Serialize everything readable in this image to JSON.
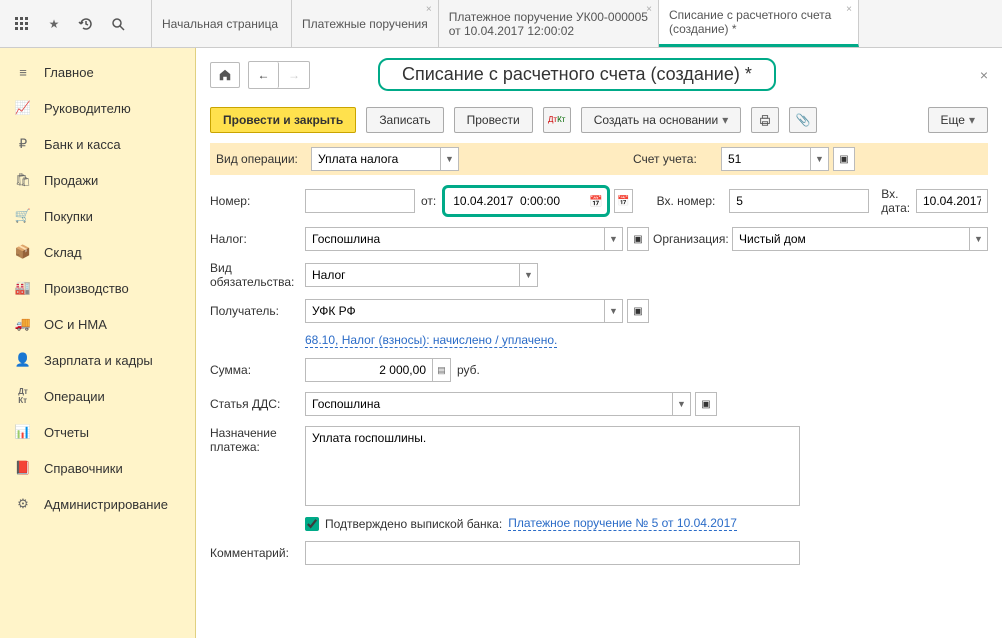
{
  "tabs": [
    {
      "label": "Начальная страница"
    },
    {
      "label": "Платежные поручения"
    },
    {
      "line1": "Платежное поручение УК00-000005",
      "line2": "от 10.04.2017 12:00:02"
    },
    {
      "line1": "Списание с расчетного счета",
      "line2": "(создание) *"
    }
  ],
  "sidebar": [
    {
      "label": "Главное",
      "icon": "home"
    },
    {
      "label": "Руководителю",
      "icon": "chart"
    },
    {
      "label": "Банк и касса",
      "icon": "ruble"
    },
    {
      "label": "Продажи",
      "icon": "bag"
    },
    {
      "label": "Покупки",
      "icon": "cart"
    },
    {
      "label": "Склад",
      "icon": "box"
    },
    {
      "label": "Производство",
      "icon": "factory"
    },
    {
      "label": "ОС и НМА",
      "icon": "truck"
    },
    {
      "label": "Зарплата и кадры",
      "icon": "person"
    },
    {
      "label": "Операции",
      "icon": "dtkt"
    },
    {
      "label": "Отчеты",
      "icon": "bars"
    },
    {
      "label": "Справочники",
      "icon": "book"
    },
    {
      "label": "Администрирование",
      "icon": "gear"
    }
  ],
  "title": "Списание с расчетного счета (создание) *",
  "toolbar": {
    "post_close": "Провести и закрыть",
    "save": "Записать",
    "post": "Провести",
    "create_based": "Создать на основании",
    "more": "Еще"
  },
  "form": {
    "op_type_label": "Вид операции:",
    "op_type_value": "Уплата налога",
    "account_label": "Счет учета:",
    "account_value": "51",
    "number_label": "Номер:",
    "number_value": "",
    "from_label": "от:",
    "date_value": "10.04.2017  0:00:00",
    "in_number_label": "Вх. номер:",
    "in_number_value": "5",
    "in_date_label": "Вх. дата:",
    "in_date_value": "10.04.2017",
    "tax_label": "Налог:",
    "tax_value": "Госпошлина",
    "org_label": "Организация:",
    "org_value": "Чистый дом",
    "obl_type_label": "Вид обязательства:",
    "obl_type_value": "Налог",
    "recipient_label": "Получатель:",
    "recipient_value": "УФК РФ",
    "account_link": "68.10, Налог (взносы): начислено / уплачено.",
    "amount_label": "Сумма:",
    "amount_value": "2 000,00",
    "currency": "руб.",
    "dds_label": "Статья ДДС:",
    "dds_value": "Госпошлина",
    "purpose_label": "Назначение платежа:",
    "purpose_value": "Уплата госпошлины.",
    "confirmed_label": "Подтверждено выпиской банка:",
    "confirmed_link": "Платежное поручение № 5 от 10.04.2017",
    "comment_label": "Комментарий:",
    "comment_value": ""
  }
}
